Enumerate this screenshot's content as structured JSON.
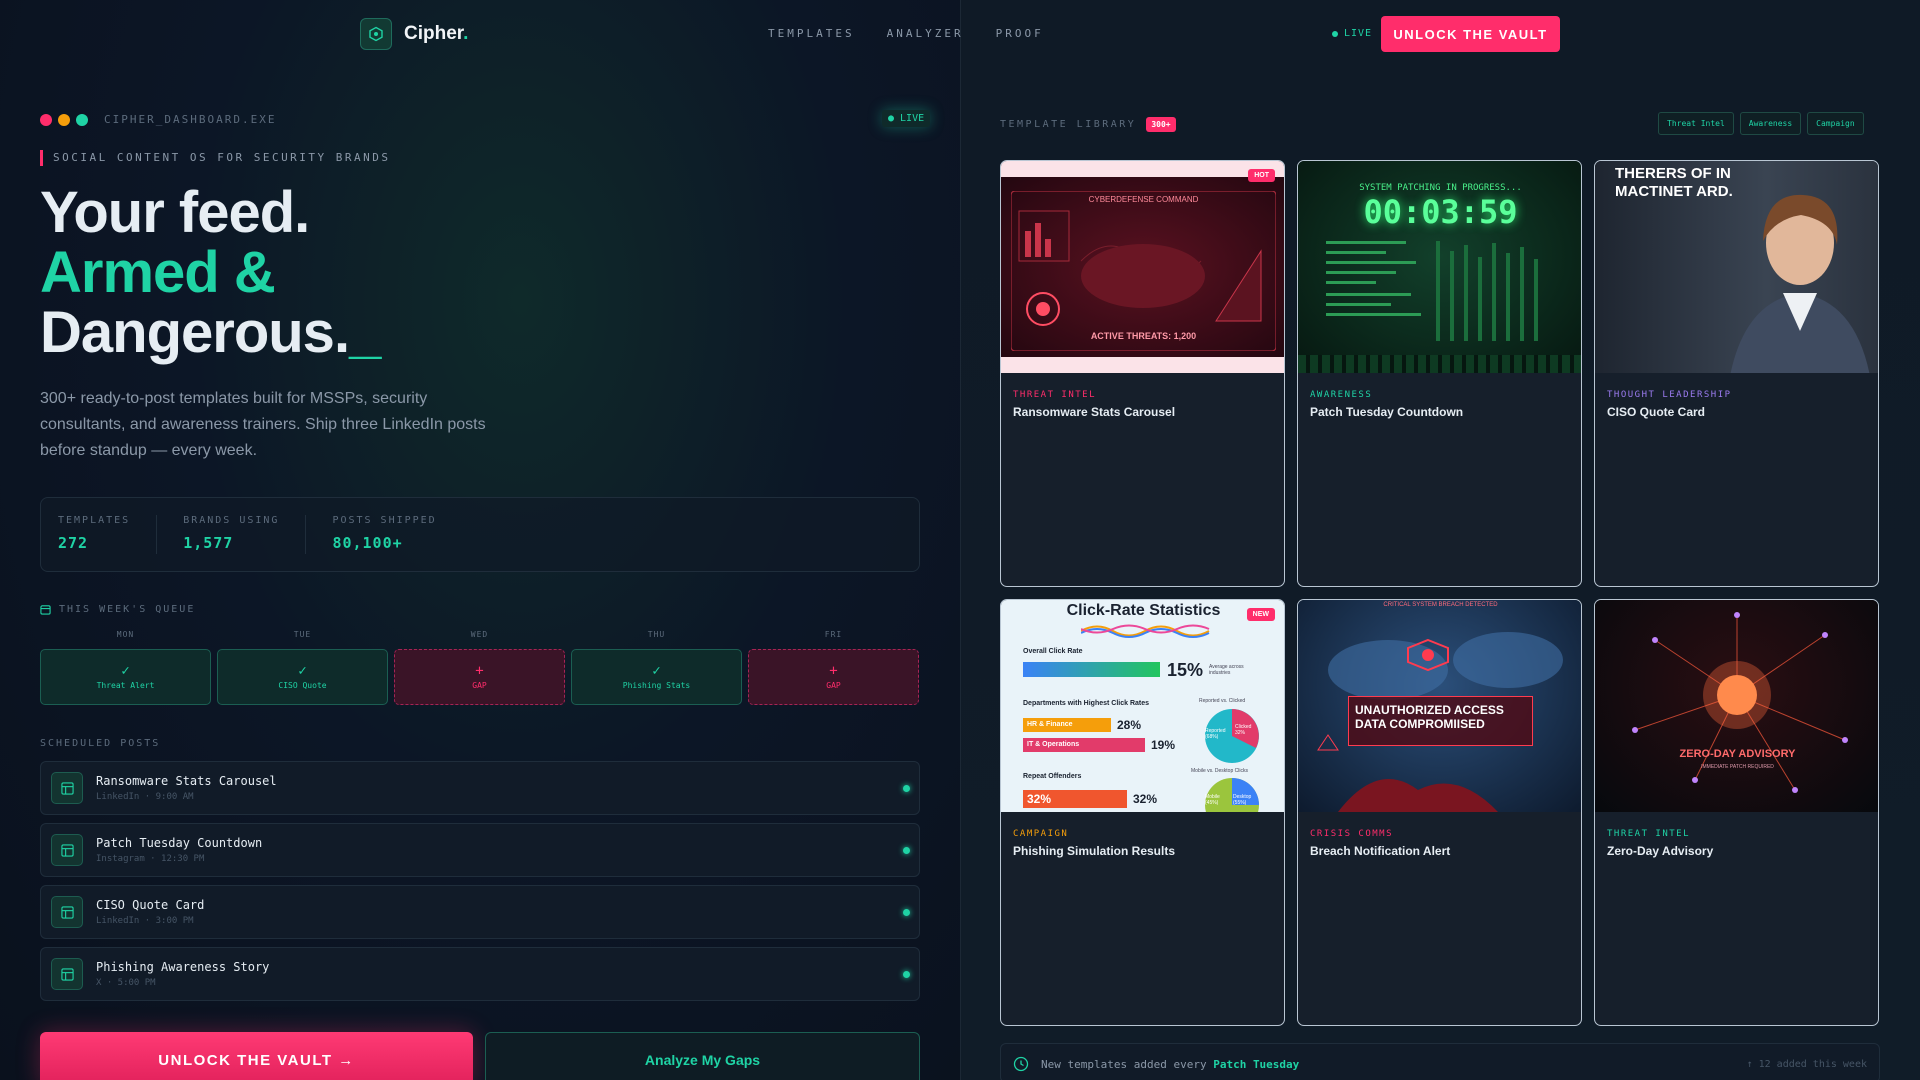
{
  "nav": {
    "brand": "Cipher",
    "brand_dot": ".",
    "links": [
      "TEMPLATES",
      "ANALYZER",
      "PROOF"
    ],
    "live": "LIVE",
    "cta": "UNLOCK THE VAULT"
  },
  "dashboard": {
    "window_title": "CIPHER_DASHBOARD.EXE",
    "live": "● LIVE",
    "tagline": "SOCIAL CONTENT OS FOR SECURITY BRANDS",
    "hero": {
      "line1": "Your feed.",
      "line2": "Armed &",
      "line3": "Dangerous.",
      "cursor": "_"
    },
    "subtitle": "300+ ready-to-post templates built for MSSPs, security consultants, and awareness trainers. Ship three LinkedIn posts before standup — every week.",
    "stats": [
      {
        "label": "TEMPLATES",
        "value": "272"
      },
      {
        "label": "BRANDS USING",
        "value": "1,577"
      },
      {
        "label": "POSTS SHIPPED",
        "value": "80,100+"
      }
    ],
    "queue_title": "THIS WEEK'S QUEUE",
    "days": [
      {
        "day": "MON",
        "status": "ok",
        "symbol": "✓",
        "label": "Threat Alert"
      },
      {
        "day": "TUE",
        "status": "ok",
        "symbol": "✓",
        "label": "CISO Quote"
      },
      {
        "day": "WED",
        "status": "gap",
        "symbol": "+",
        "label": "GAP"
      },
      {
        "day": "THU",
        "status": "ok",
        "symbol": "✓",
        "label": "Phishing Stats"
      },
      {
        "day": "FRI",
        "status": "gap",
        "symbol": "+",
        "label": "GAP"
      }
    ],
    "scheduled_title": "SCHEDULED POSTS",
    "posts": [
      {
        "title": "Ransomware Stats Carousel",
        "meta": "LinkedIn · 9:00 AM"
      },
      {
        "title": "Patch Tuesday Countdown",
        "meta": "Instagram · 12:30 PM"
      },
      {
        "title": "CISO Quote Card",
        "meta": "LinkedIn · 3:00 PM"
      },
      {
        "title": "Phishing Awareness Story",
        "meta": "X · 5:00 PM"
      }
    ],
    "cta_primary": "UNLOCK THE VAULT →",
    "cta_secondary": "Analyze My Gaps"
  },
  "library": {
    "title": "TEMPLATE LIBRARY",
    "count": "300+",
    "filters": [
      "Threat Intel",
      "Awareness",
      "Campaign"
    ],
    "cards": [
      {
        "category": "THREAT INTEL",
        "cat_color": "#ff2d6b",
        "title": "Ransomware Stats Carousel",
        "badge": "HOT",
        "img_caption": "CYBERDEFENSE COMMAND",
        "img_sub": "ACTIVE THREATS: 1,200"
      },
      {
        "category": "AWARENESS",
        "cat_color": "#1fd3a5",
        "title": "Patch Tuesday Countdown",
        "badge": "",
        "img_caption": "SYSTEM PATCHING IN PROGRESS...",
        "img_sub": "00:03:59"
      },
      {
        "category": "THOUGHT LEADERSHIP",
        "cat_color": "#9b7bf0",
        "title": "CISO Quote Card",
        "badge": "",
        "img_caption": "THERERS OF IN MACTINET ARD.",
        "img_sub": ""
      },
      {
        "category": "CAMPAIGN",
        "cat_color": "#f59e0b",
        "title": "Phishing Simulation Results",
        "badge": "NEW",
        "img_caption": "Click-Rate Statistics",
        "img_sub": "15%"
      },
      {
        "category": "CRISIS COMMS",
        "cat_color": "#ff2d6b",
        "title": "Breach Notification Alert",
        "badge": "",
        "img_caption": "UNAUTHORIZED ACCESS DATA COMPROMIISED",
        "img_sub": "CRITICAL SYSTEM BREACH DETECTED"
      },
      {
        "category": "THREAT INTEL",
        "cat_color": "#1fd3a5",
        "title": "Zero-Day Advisory",
        "badge": "",
        "img_caption": "ZERO-DAY ADVISORY",
        "img_sub": "IMMEDIATE PATCH REQUIRED"
      }
    ],
    "phish": {
      "overall_label": "Overall Click Rate",
      "overall_value": "15%",
      "overall_note": "Average across industries",
      "dept_title": "Departments with Highest Click Rates",
      "depts": [
        {
          "name": "HR & Finance",
          "value": "28%"
        },
        {
          "name": "IT & Operations",
          "value": "19%"
        }
      ],
      "repeat_label": "Repeat Offenders",
      "repeat_value": "32%",
      "repeat_value2": "32%",
      "pie1_title": "Reported vs. Clicked",
      "pie1_a": "Reported (68%)",
      "pie1_b": "Clicked 32%",
      "pie2_title": "Mobile vs. Desktop Clicks",
      "pie2_a": "Mobile (45%)",
      "pie2_b": "Desktop (55%)"
    },
    "footer_text": "New templates added every",
    "footer_bold": "Patch Tuesday",
    "footer_right": "↑ 12 added this week"
  },
  "colors": {
    "accent": "#1fd3a5",
    "brand": "#ff2d6b",
    "bg": "#0b1220"
  }
}
